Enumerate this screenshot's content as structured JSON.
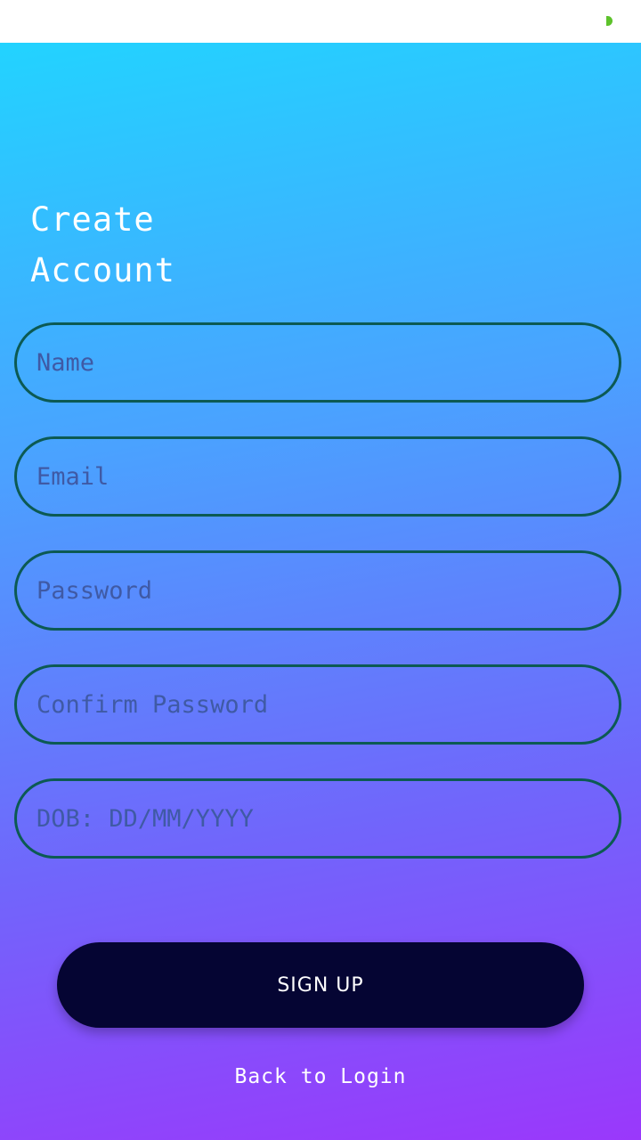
{
  "status_bar": {
    "indicator_color": "#5dc22b"
  },
  "header": {
    "title": "Create\nAccount"
  },
  "form": {
    "name_placeholder": "Name",
    "email_placeholder": "Email",
    "password_placeholder": "Password",
    "confirm_password_placeholder": "Confirm Password",
    "dob_placeholder": "DOB: DD/MM/YYYY"
  },
  "actions": {
    "signup_label": "SIGN UP",
    "back_to_login_label": "Back to Login"
  },
  "colors": {
    "gradient_top": "#22d3ff",
    "gradient_bottom": "#9a38fb",
    "field_border": "#0c5a53",
    "button_bg": "#050533"
  }
}
